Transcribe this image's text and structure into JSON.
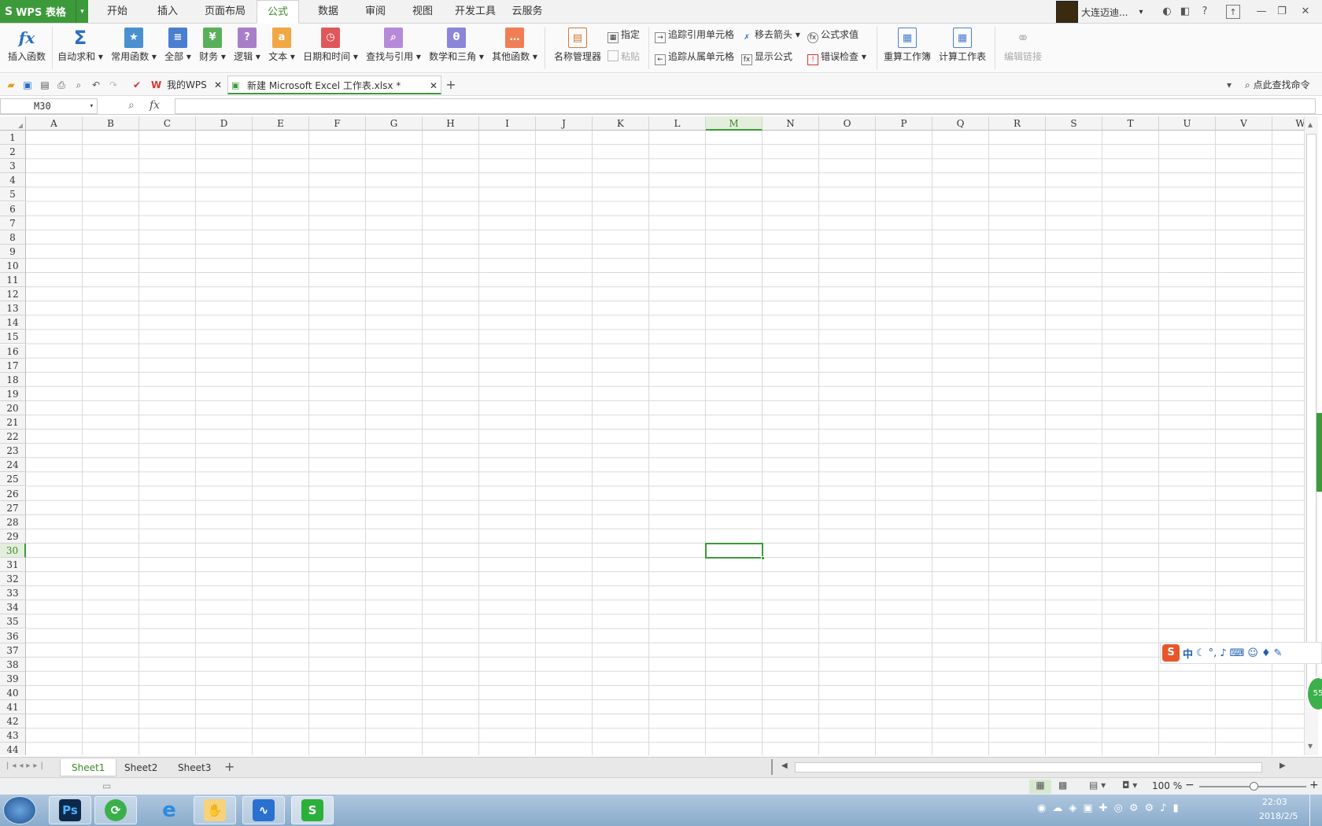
{
  "app": {
    "name": "WPS 表格"
  },
  "menu_tabs": [
    "开始",
    "插入",
    "页面布局",
    "公式",
    "数据",
    "审阅",
    "视图",
    "开发工具",
    "云服务"
  ],
  "active_menu_tab": "公式",
  "user": {
    "name": "大连迈迪..."
  },
  "ribbon": {
    "insert_function": "插入函数",
    "autosum": "自动求和",
    "common": "常用函数",
    "all": "全部",
    "finance": "财务",
    "logic": "逻辑",
    "text": "文本",
    "datetime": "日期和时间",
    "lookup": "查找与引用",
    "math": "数学和三角",
    "other": "其他函数",
    "name_manager": "名称管理器",
    "assign": "指定",
    "paste": "粘贴",
    "trace_precedents": "追踪引用单元格",
    "trace_dependents": "追踪从属单元格",
    "remove_arrows": "移去箭头",
    "show_formulas": "显示公式",
    "evaluate": "公式求值",
    "error_check": "错误检查",
    "recalc_book": "重算工作簿",
    "calc_sheet": "计算工作表",
    "edit_links": "编辑链接"
  },
  "doc_tabs": [
    {
      "label": "我的WPS"
    },
    {
      "label": "新建 Microsoft Excel 工作表.xlsx *"
    }
  ],
  "search_cmd": "点此查找命令",
  "formula_bar": {
    "name_box": "M30",
    "fx": "fx",
    "value": ""
  },
  "columns": [
    "A",
    "B",
    "C",
    "D",
    "E",
    "F",
    "G",
    "H",
    "I",
    "J",
    "K",
    "L",
    "M",
    "N",
    "O",
    "P",
    "Q",
    "R",
    "S",
    "T",
    "U",
    "V",
    "W"
  ],
  "rows": [
    "1",
    "2",
    "3",
    "4",
    "5",
    "6",
    "7",
    "8",
    "9",
    "10",
    "11",
    "12",
    "13",
    "14",
    "15",
    "16",
    "17",
    "18",
    "19",
    "20",
    "21",
    "22",
    "23",
    "24",
    "25",
    "26",
    "27",
    "28",
    "29",
    "30",
    "31",
    "32",
    "33",
    "34",
    "35",
    "36",
    "37",
    "38",
    "39",
    "40",
    "41",
    "42",
    "43",
    "44"
  ],
  "selected": {
    "col": "M",
    "row": "30"
  },
  "sheets": [
    "Sheet1",
    "Sheet2",
    "Sheet3"
  ],
  "active_sheet": "Sheet1",
  "status": {
    "zoom": "100 %"
  },
  "taskbar": {
    "time": "22:03",
    "date": "2018/2/5",
    "ime_label": "中"
  },
  "colors": {
    "accent": "#3c9a3a"
  }
}
